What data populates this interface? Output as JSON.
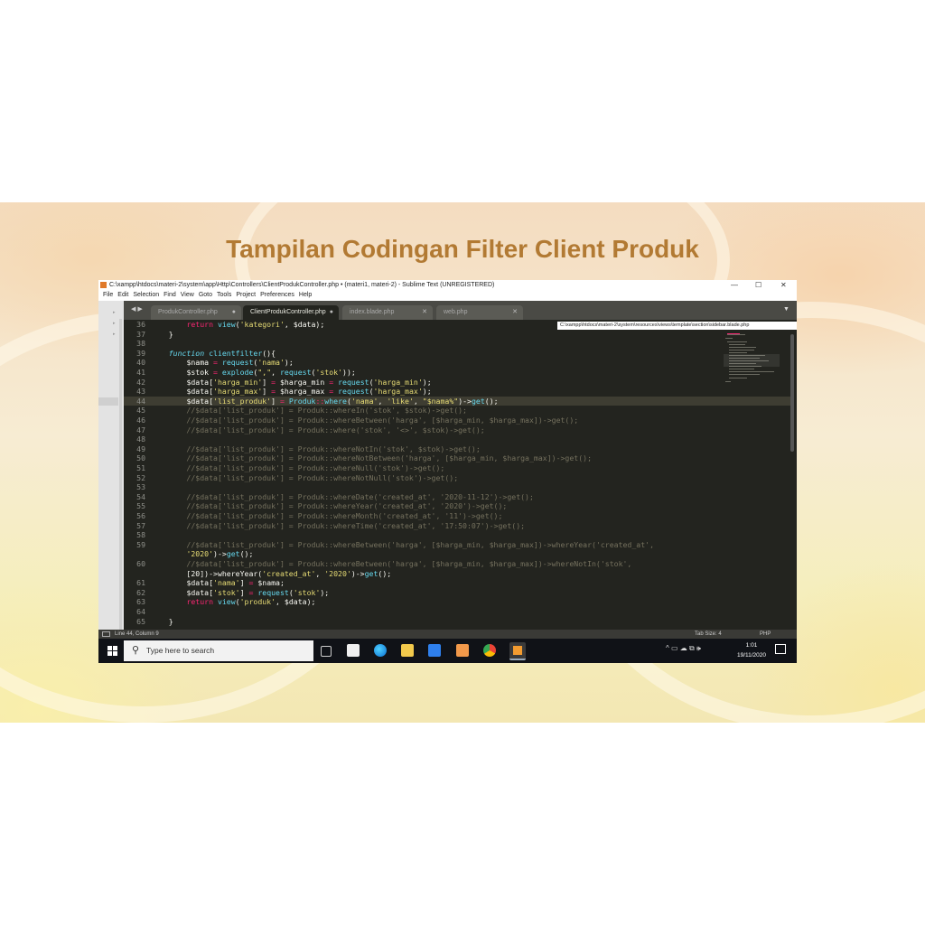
{
  "slide": {
    "title": "Tampilan Codingan Filter Client Produk"
  },
  "window": {
    "title": "C:\\xampp\\htdocs\\materi-2\\system\\app\\Http\\Controllers\\ClientProdukController.php • (materi1, materi-2) - Sublime Text (UNREGISTERED)",
    "minimize": "—",
    "maximize": "☐",
    "close": "✕"
  },
  "menu": [
    "File",
    "Edit",
    "Selection",
    "Find",
    "View",
    "Goto",
    "Tools",
    "Project",
    "Preferences",
    "Help"
  ],
  "tabs": [
    {
      "label": "ProdukController.php",
      "active": false,
      "close": "●"
    },
    {
      "label": "ClientProdukController.php",
      "active": true,
      "close": "●"
    },
    {
      "label": "index.blade.php",
      "active": false,
      "close": "✕"
    },
    {
      "label": "web.php",
      "active": false,
      "close": "✕"
    }
  ],
  "tab_nav": "◀ ▶",
  "tab_dropdown": "▼",
  "tooltip": "C:\\xampp\\htdocs\\materi-2\\system\\resources\\views\\template\\section\\sidebar.blade.php",
  "code": [
    {
      "n": "36",
      "t": "        return view('kategori', $data);"
    },
    {
      "n": "37",
      "t": "    }"
    },
    {
      "n": "38",
      "t": ""
    },
    {
      "n": "39",
      "t": "    function clientfilter(){"
    },
    {
      "n": "40",
      "t": "        $nama = request('nama');"
    },
    {
      "n": "41",
      "t": "        $stok = explode(\",\", request('stok'));"
    },
    {
      "n": "42",
      "t": "        $data['harga_min'] = $harga_min = request('harga_min');"
    },
    {
      "n": "43",
      "t": "        $data['harga_max'] = $harga_max = request('harga_max');"
    },
    {
      "n": "44",
      "t": "        $data['list_produk'] = Produk::where('nama', 'like', \"$nama%\")->get();"
    },
    {
      "n": "45",
      "t": "        //$data['list_produk'] = Produk::whereIn('stok', $stok)->get();"
    },
    {
      "n": "46",
      "t": "        //$data['list_produk'] = Produk::whereBetween('harga', [$harga_min, $harga_max])->get();"
    },
    {
      "n": "47",
      "t": "        //$data['list_produk'] = Produk::where('stok', '<>', $stok)->get();"
    },
    {
      "n": "48",
      "t": ""
    },
    {
      "n": "49",
      "t": "        //$data['list_produk'] = Produk::whereNotIn('stok', $stok)->get();"
    },
    {
      "n": "50",
      "t": "        //$data['list_produk'] = Produk::whereNotBetween('harga', [$harga_min, $harga_max])->get();"
    },
    {
      "n": "51",
      "t": "        //$data['list_produk'] = Produk::whereNull('stok')->get();"
    },
    {
      "n": "52",
      "t": "        //$data['list_produk'] = Produk::whereNotNull('stok')->get();"
    },
    {
      "n": "53",
      "t": ""
    },
    {
      "n": "54",
      "t": "        //$data['list_produk'] = Produk::whereDate('created_at', '2020-11-12')->get();"
    },
    {
      "n": "55",
      "t": "        //$data['list_produk'] = Produk::whereYear('created_at', '2020')->get();"
    },
    {
      "n": "56",
      "t": "        //$data['list_produk'] = Produk::whereMonth('created_at', '11')->get();"
    },
    {
      "n": "57",
      "t": "        //$data['list_produk'] = Produk::whereTime('created_at', '17:50:07')->get();"
    },
    {
      "n": "58",
      "t": ""
    },
    {
      "n": "59",
      "t": "        //$data['list_produk'] = Produk::whereBetween('harga', [$harga_min, $harga_max])->whereYear('created_at',"
    },
    {
      "n": "",
      "t": "        '2020')->get();"
    },
    {
      "n": "60",
      "t": "        //$data['list_produk'] = Produk::whereBetween('harga', [$harga_min, $harga_max])->whereNotIn('stok',"
    },
    {
      "n": "",
      "t": "        [20])->whereYear('created_at', '2020')->get();"
    },
    {
      "n": "61",
      "t": "        $data['nama'] = $nama;"
    },
    {
      "n": "62",
      "t": "        $data['stok'] = request('stok');"
    },
    {
      "n": "63",
      "t": "        return view('produk', $data);"
    },
    {
      "n": "64",
      "t": ""
    },
    {
      "n": "65",
      "t": "    }"
    }
  ],
  "statusbar": {
    "position": "Line 44, Column 9",
    "tab_size": "Tab Size: 4",
    "syntax": "PHP"
  },
  "taskbar": {
    "search_placeholder": "Type here to search",
    "time": "1:01",
    "date": "19/11/2020",
    "icons": [
      "task-view-icon",
      "store-icon",
      "edge-icon",
      "file-explorer-icon",
      "mail-icon",
      "xampp-icon",
      "chrome-icon",
      "sublime-text-icon"
    ],
    "tray": "^ ▭ ☁ ⧉ 🕪"
  },
  "colors": {
    "editor_bg": "#23241f",
    "title_color": "#b27a33",
    "keyword": "#f92672",
    "function": "#66d9ef",
    "string": "#e6db74",
    "comment": "#75715e",
    "variable": "#fd971f"
  }
}
